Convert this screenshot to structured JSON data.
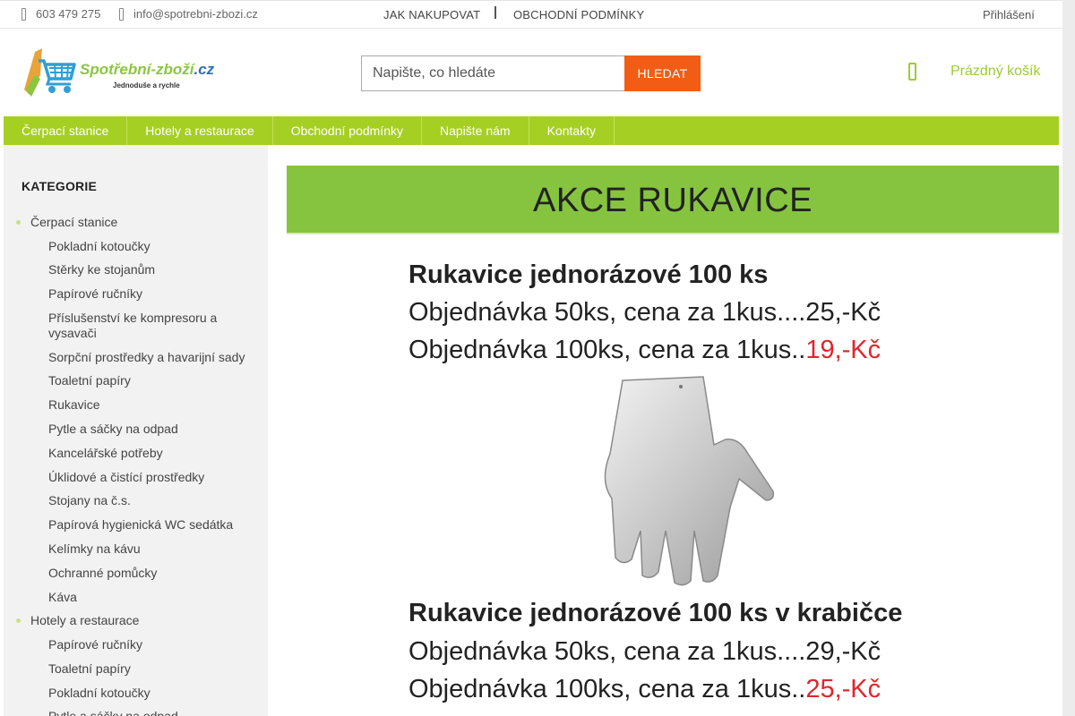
{
  "topbar": {
    "phone": "603 479 275",
    "email": "info@spotrebni-zbozi.cz",
    "links": [
      "JAK NAKUPOVAT",
      "OBCHODNÍ PODMÍNKY"
    ],
    "login": "Přihlášení"
  },
  "header": {
    "logo_brand_a": "Spotřební-zboží",
    "logo_brand_b": ".cz",
    "logo_tagline": "Jednoduše a rychle",
    "search_placeholder": "Napište, co hledáte",
    "search_button": "HLEDAT",
    "cart_label": "Prázdný košík"
  },
  "menu": [
    "Čerpací stanice",
    "Hotely a restaurace",
    "Obchodní podmínky",
    "Napište nám",
    "Kontakty"
  ],
  "sidebar": {
    "title": "KATEGORIE",
    "groups": [
      {
        "label": "Čerpací stanice",
        "items": [
          "Pokladní kotoučky",
          "Stěrky ke stojanům",
          "Papírové ručníky",
          "Příslušenství ke kompresoru a vysavači",
          "Sorpční prostředky a havarijní sady",
          "Toaletní papíry",
          "Rukavice",
          "Pytle a sáčky na odpad",
          "Kancelářské potřeby",
          "Úklidové a čistící prostředky",
          "Stojany na č.s.",
          "Papírová hygienická WC sedátka",
          "Kelímky na kávu",
          "Ochranné pomůcky",
          "Káva"
        ]
      },
      {
        "label": "Hotely a restaurace",
        "items": [
          "Papírové ručníky",
          "Toaletní papíry",
          "Pokladní kotoučky",
          "Pytle a sáčky na odpad"
        ]
      }
    ]
  },
  "banner": {
    "title": "AKCE RUKAVICE",
    "block1": {
      "heading": "Rukavice jednorázové 100 ks",
      "line1": "Objednávka 50ks, cena za 1kus....25,-Kč",
      "line2_prefix": "Objednávka 100ks, cena za 1kus..",
      "line2_price": "19,-Kč"
    },
    "block2": {
      "heading": "Rukavice jednorázové 100 ks v krabičce",
      "line1": "Objednávka 50ks, cena za 1kus....29,-Kč",
      "line2_prefix": "Objednávka 100ks, cena za 1kus..",
      "line2_price": "25,-Kč"
    }
  },
  "colors": {
    "accent_green": "#a6cf23",
    "search_orange": "#f25c15",
    "price_red": "#e0262c",
    "banner_green": "#86c440"
  }
}
